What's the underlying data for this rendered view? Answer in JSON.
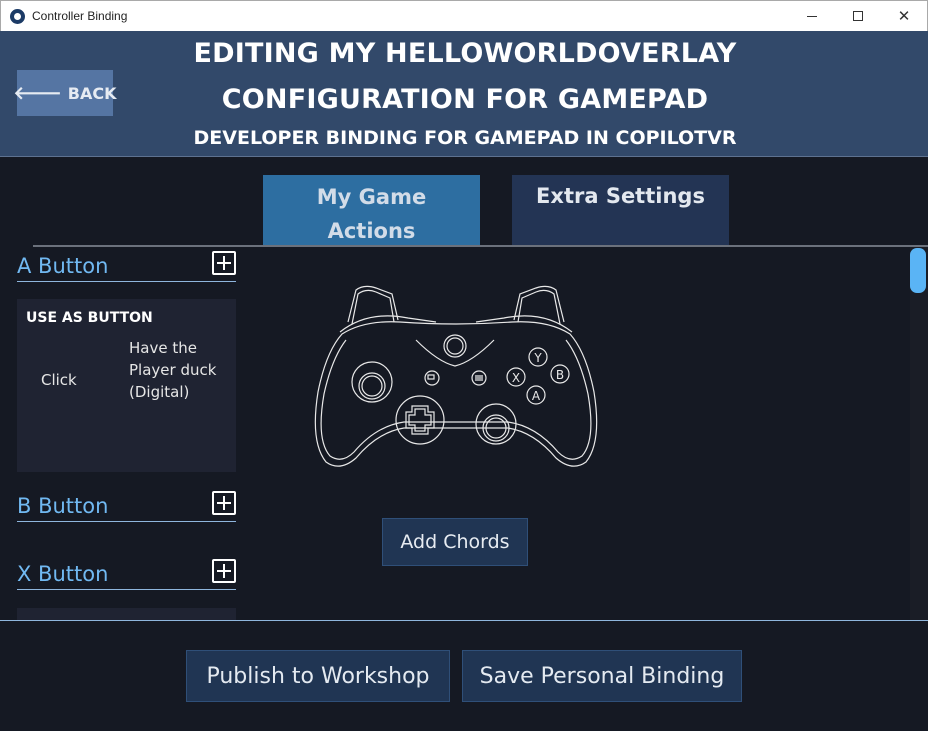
{
  "window": {
    "title": "Controller Binding",
    "controls": {
      "minimize": "minimize",
      "maximize": "maximize",
      "close": "✕"
    }
  },
  "header": {
    "back_label": "BACK",
    "title_line1": "EDITING MY HELLOWORLDOVERLAY",
    "title_line2": "CONFIGURATION FOR GAMEPAD",
    "subtitle": "DEVELOPER BINDING FOR GAMEPAD IN COPILOTVR"
  },
  "tabs": [
    {
      "label_line1": "My Game",
      "label_line2": "Actions",
      "active": true
    },
    {
      "label_line1": "Extra Settings",
      "label_line2": "",
      "active": false
    }
  ],
  "bindings": [
    {
      "label": "A Button",
      "mode": "USE AS BUTTON",
      "input": "Click",
      "action": "Have the Player duck (Digital)"
    },
    {
      "label": "B Button"
    },
    {
      "label": "X Button"
    }
  ],
  "controller": {
    "face_buttons": [
      "Y",
      "B",
      "X",
      "A"
    ]
  },
  "add_chords_label": "Add Chords",
  "footer": {
    "publish_label": "Publish to Workshop",
    "save_label": "Save Personal Binding"
  },
  "colors": {
    "header_bg": "#32496a",
    "body_bg": "#151923",
    "active_tab": "#2d6ea1",
    "inactive_tab": "#233454",
    "accent_label": "#71b9f2",
    "button_bg": "#203553",
    "scroll_thumb": "#5ab4f5"
  }
}
